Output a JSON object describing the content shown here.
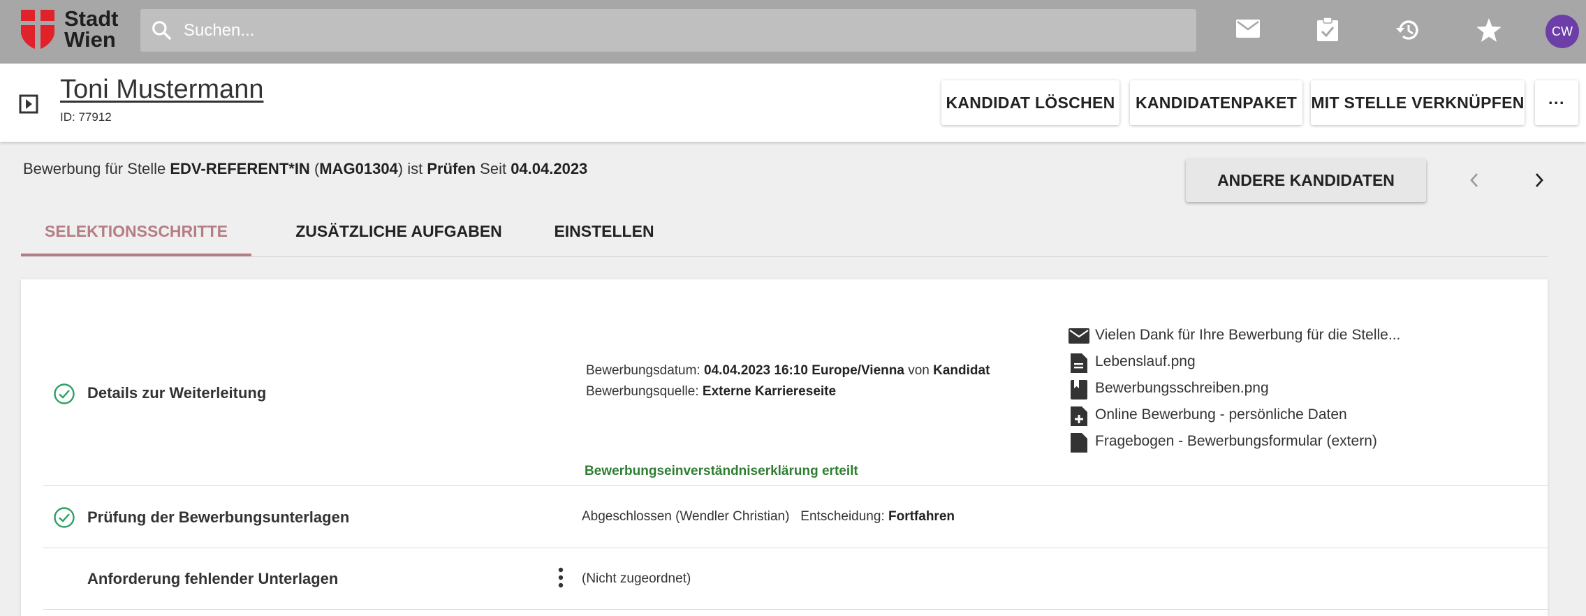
{
  "app": {
    "logo_line1": "Stadt",
    "logo_line2": "Wien",
    "search_placeholder": "Suchen...",
    "avatar_initials": "CW",
    "brand_red": "#e2222b",
    "avatar_color": "#6c3ea8"
  },
  "header": {
    "name": "Toni Mustermann",
    "id_text": "ID: 77912",
    "buttons": {
      "delete": "KANDIDAT LÖSCHEN",
      "package": "KANDIDATENPAKET",
      "link": "MIT STELLE VERKNÜPFEN",
      "more": "···"
    }
  },
  "status": {
    "prefix": "Bewerbung für Stelle ",
    "job": "EDV-REFERENT*IN",
    "open_paren": " (",
    "job_code": "MAG01304",
    "mid": ") ist ",
    "state": "Prüfen",
    "since_label": " Seit ",
    "since_date": "04.04.2023",
    "andere_button": "ANDERE KANDIDATEN"
  },
  "tabs": [
    {
      "label": "SELEKTIONSSCHRITTE",
      "active": true
    },
    {
      "label": "ZUSÄTZLICHE AUFGABEN",
      "active": false
    },
    {
      "label": "EINSTELLEN",
      "active": false
    }
  ],
  "steps": {
    "step1": {
      "title": "Details zur Weiterleitung",
      "date_label": "Bewerbungsdatum: ",
      "date_value": "04.04.2023 16:10 Europe/Vienna",
      "by_label": " von ",
      "by_value": "Kandidat",
      "source_label": "Bewerbungsquelle: ",
      "source_value": "Externe Karriereseite",
      "consent": "Bewerbungseinverständniserklärung erteilt",
      "documents": [
        {
          "label": "Vielen Dank für Ihre Bewerbung für die Stelle...",
          "icon": "mail-icon"
        },
        {
          "label": "Lebenslauf.png",
          "icon": "document-icon"
        },
        {
          "label": "Bewerbungsschreiben.png",
          "icon": "bookmark-document-icon"
        },
        {
          "label": "Online Bewerbung - persönliche Daten",
          "icon": "document-add-icon"
        },
        {
          "label": "Fragebogen - Bewerbungsformular (extern)",
          "icon": "document-icon"
        }
      ]
    },
    "step2": {
      "title": "Prüfung der Bewerbungsunterlagen",
      "status": "Abgeschlossen (Wendler Christian)",
      "decision_label": "Entscheidung: ",
      "decision_value": "Fortfahren"
    },
    "step3": {
      "title": "Anforderung fehlender Unterlagen",
      "status": "(Nicht zugeordnet)"
    }
  }
}
